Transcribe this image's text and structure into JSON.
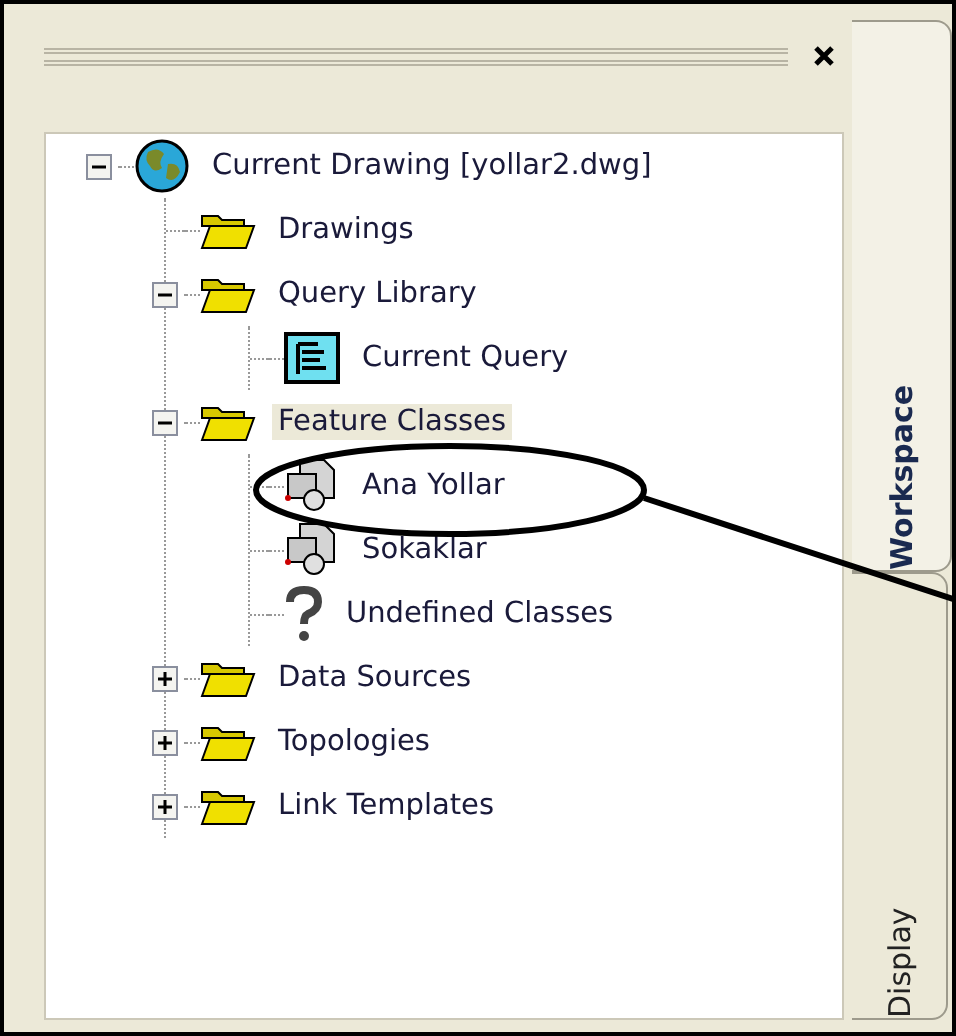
{
  "tree": [
    {
      "label": "Current Drawing [yollar2.dwg]",
      "kind": "globe",
      "expanded": true,
      "selected": false,
      "children": [
        {
          "label": "Drawings",
          "kind": "folder",
          "selected": false
        },
        {
          "label": "Query Library",
          "kind": "folder",
          "expanded": true,
          "selected": false,
          "children": [
            {
              "label": "Current Query",
              "kind": "query",
              "selected": false
            }
          ]
        },
        {
          "label": "Feature Classes",
          "kind": "folder",
          "expanded": true,
          "selected": true,
          "children": [
            {
              "label": "Ana Yollar",
              "kind": "feature",
              "selected": false
            },
            {
              "label": "Sokaklar",
              "kind": "feature",
              "selected": false
            },
            {
              "label": "Undefined Classes",
              "kind": "unknown",
              "selected": false
            }
          ]
        },
        {
          "label": "Data Sources",
          "kind": "folder",
          "expanded": false,
          "selected": false
        },
        {
          "label": "Topologies",
          "kind": "folder",
          "expanded": false,
          "selected": false
        },
        {
          "label": "Link Templates",
          "kind": "folder",
          "expanded": false,
          "selected": false
        }
      ]
    }
  ],
  "tabs": [
    {
      "label": "Workspace",
      "selected": true
    },
    {
      "label": "Display",
      "selected": false
    }
  ]
}
